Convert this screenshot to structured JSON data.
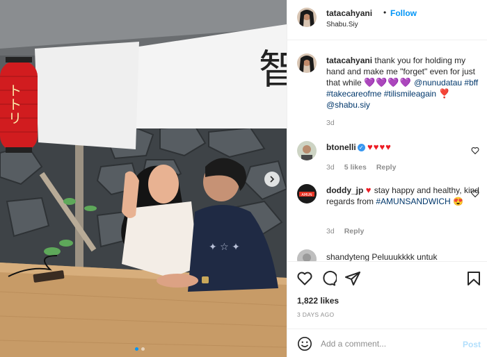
{
  "colors": {
    "accent": "#0095f6",
    "text": "#262626",
    "muted": "#8e8e8e",
    "hashtag": "#00376b",
    "heart": "#ed1c24"
  },
  "photo": {
    "lantern_text": "トトリ",
    "banner_text": "智",
    "carousel_position": 1,
    "carousel_total": 2,
    "next_icon": "chevron-right-icon"
  },
  "header": {
    "username": "tatacahyani",
    "separator": "•",
    "follow_label": "Follow",
    "location": "Shabu.Siy"
  },
  "caption": {
    "username": "tatacahyani",
    "text_before": "thank you for holding my hand and make me \"forget\" even for just that while",
    "emojis": "💜💜💜💜",
    "mention1": "@nunudatau",
    "hashtags": "#bff #takecareofme #tilismileagain",
    "heart": "❣️",
    "mention2": "@shabu.siy",
    "time": "3d"
  },
  "comments": [
    {
      "username": "btonelli",
      "verified": true,
      "text": "",
      "emojis": "♥♥♥♥",
      "time": "3d",
      "likes": "5 likes",
      "reply": "Reply"
    },
    {
      "username": "doddy_jp",
      "verified": false,
      "heart": "♥",
      "text": "stay happy and healthy, kind regards from",
      "tag": "#AMUNSANDWICH",
      "emoji": "😍",
      "time": "3d",
      "reply": "Reply"
    },
    {
      "username": "shandyteng",
      "text": "Peluuukkkk untuk"
    }
  ],
  "actions": {
    "like_icon": "heart-icon",
    "comment_icon": "comment-icon",
    "share_icon": "share-icon",
    "save_icon": "bookmark-icon",
    "likes_count": "1,822 likes",
    "date": "3 DAYS AGO"
  },
  "add_comment": {
    "emoji_icon": "smile-icon",
    "placeholder": "Add a comment...",
    "post_label": "Post"
  }
}
